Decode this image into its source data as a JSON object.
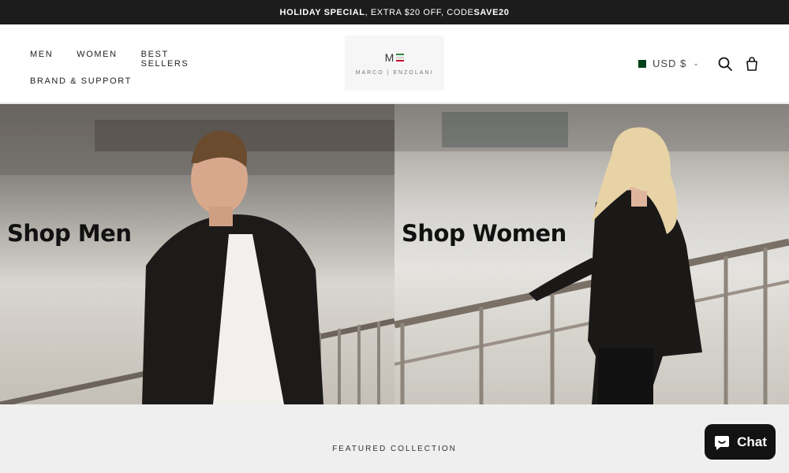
{
  "announcement": {
    "part1": "HOLIDAY SPECIAL",
    "part2": ", EXTRA $20 OFF, CODE ",
    "part3": "SAVE20"
  },
  "nav": {
    "men": "MEN",
    "women": "WOMEN",
    "best_sellers": "BEST SELLERS",
    "brand_support": "BRAND & SUPPORT"
  },
  "logo": {
    "mark": "M",
    "text": "MARCO | ENZOLANI"
  },
  "currency": {
    "label": "USD $",
    "flag": "pakistan-flag-icon"
  },
  "icons": {
    "search": "search-icon",
    "cart": "cart-icon"
  },
  "hero": {
    "men_title": "Shop Men",
    "women_title": "Shop Women"
  },
  "featured": {
    "label": "FEATURED COLLECTION"
  },
  "chat": {
    "label": "Chat"
  },
  "colors": {
    "announce_bg": "#1c1c1c",
    "logo_green": "#2d8a3d",
    "logo_red": "#c8102e"
  }
}
